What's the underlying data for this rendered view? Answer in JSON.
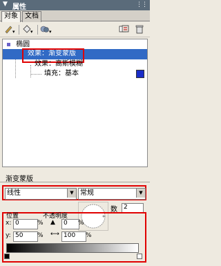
{
  "panel": {
    "title": "属性"
  },
  "tabs": [
    {
      "label": "对象"
    },
    {
      "label": "文档"
    }
  ],
  "tree": {
    "root": "椭圆",
    "item1": "效果：渐变蒙版",
    "item2": "效果：高斯模糊",
    "item3": "填充：基本"
  },
  "gradient_panel": {
    "title": "渐变蒙版",
    "type_select": "线性",
    "mode_select": "常规",
    "count_label": "数",
    "count_value": "2",
    "position_label": "位置",
    "opacity_label": "不透明度",
    "position_value": "0",
    "position_unit": "%",
    "opacity_value": "0",
    "opacity_unit": "%",
    "row2_value1": "50",
    "row2_unit1": "%",
    "row2_value2": "100",
    "row2_unit2": "%"
  },
  "colors": {
    "accent": "#e00000",
    "selection": "#316ac5",
    "swatch": "#1a2dc8"
  }
}
